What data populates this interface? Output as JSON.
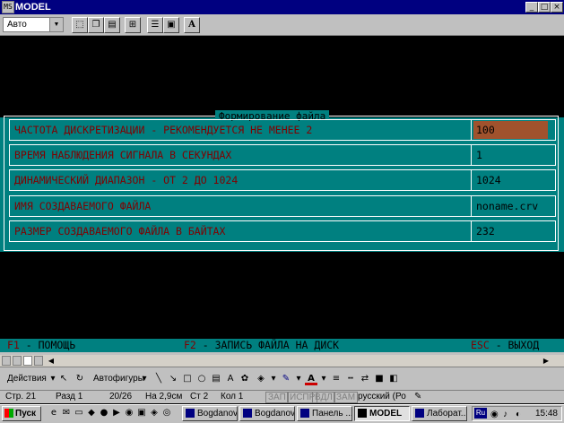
{
  "window": {
    "title": "MODEL",
    "controls": [
      "_",
      "□",
      "×"
    ]
  },
  "dos_toolbar": {
    "font_value": "Авто",
    "button_A": "A"
  },
  "dialog": {
    "title": "Формирование файла",
    "rows": [
      {
        "label": "ЧАСТОТА ДИСКРЕТИЗАЦИИ - РЕКОМЕНДУЕТСЯ НЕ МЕНЕЕ 2",
        "value": "100"
      },
      {
        "label": "ВРЕМЯ НАБЛЮДЕНИЯ СИГНАЛА В СЕКУНДАХ",
        "value": "1"
      },
      {
        "label": "ДИНАМИЧЕСКИЙ ДИАПАЗОН - ОТ 2 ДО 1024",
        "value": "1024"
      },
      {
        "label": "ИМЯ СОЗДАВАЕМОГО ФАЙЛА",
        "value": "noname.crv"
      },
      {
        "label": "РАЗМЕР СОЗДАВАЕМОГО ФАЙЛА В БАЙТАХ",
        "value": "232"
      }
    ]
  },
  "dos_hotkeys": {
    "f1_key": "F1",
    "f1_text": " - ПОМОЩЬ",
    "f2_key": "F2",
    "f2_text": " - ЗАПИСЬ ФАЙЛА НА ДИСК",
    "esc_key": "ESC",
    "esc_text": " - ВЫХОД"
  },
  "drawing_toolbar": {
    "actions_label": "Действия",
    "autoshapes_label": "Автофигуры"
  },
  "status_bar": {
    "page": "Стр. 21",
    "section": "Разд 1",
    "page_of": "20/26",
    "at": "На 2,9см",
    "line": "Ст 2",
    "col": "Кол 1",
    "rec": "ЗАП",
    "trk": "ИСПР",
    "ext": "ВДЛ",
    "ovr": "ЗАМ",
    "language": "русский (Ро"
  },
  "taskbar": {
    "start_label": "Пуск",
    "tasks": [
      "Bogdanov",
      "Bogdanov",
      "Панель ...",
      "MODEL",
      "Лаборат..."
    ],
    "lang": "Ru",
    "clock": "15:48"
  }
}
